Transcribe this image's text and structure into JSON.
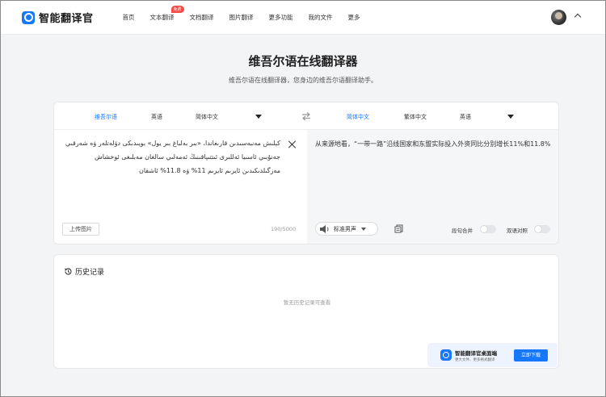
{
  "nav": {
    "logo_text": "智能翻译官",
    "menu": [
      {
        "label": "首页"
      },
      {
        "label": "文本翻译",
        "badge": "免费"
      },
      {
        "label": "文档翻译"
      },
      {
        "label": "图片翻译"
      },
      {
        "label": "更多功能"
      },
      {
        "label": "我的文件"
      },
      {
        "label": "更多"
      }
    ]
  },
  "hero": {
    "title": "维吾尔语在线翻译器",
    "subtitle": "维吾尔语在线翻译器，您身边的维吾尔语翻译助手。"
  },
  "source_langs": [
    "维吾尔语",
    "英语",
    "简体中文"
  ],
  "target_langs": [
    "简体中文",
    "繁体中文",
    "英语"
  ],
  "source": {
    "text": "كېلىش مەنبەسىدىن قارىغاندا، «بىر بەلباغ بىر يول» بويىدىكى دۆلەتلەر ۋە شەرقىي جەنۇبىي ئاسىيا ئەللىرى ئىتتىپاقىنىڭ ئەمەلىي سالغان مەبلىغى ئوخشاش مەزگىلدىكىدىن ئايرىم ئايرىم 11% ۋە 11.8% ئاشقان",
    "upload_label": "上传图片",
    "counter": "190/5000"
  },
  "target": {
    "text": "从来源地看，“一带一路”沿线国家和东盟实际投入外资同比分别增长11%和11.8%",
    "voice_label": "标准男声",
    "paragraph_merge_label": "段句合并",
    "bilingual_label": "双语对照"
  },
  "history": {
    "title": "历史记录",
    "empty_text": "暂无历史记录可查看"
  },
  "download": {
    "title": "智能翻译官桌面端",
    "subtitle": "更大文件、更多格式翻译",
    "button_label": "立即下载"
  },
  "colors": {
    "accent": "#1677ff",
    "badge": "#f54a45",
    "page_bg": "#f3f4f6"
  }
}
